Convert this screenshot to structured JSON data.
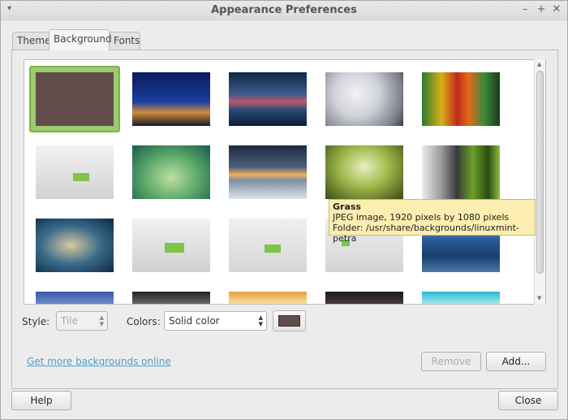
{
  "window": {
    "title": "Appearance Preferences"
  },
  "tabs": [
    {
      "label": "Theme"
    },
    {
      "label": "Background",
      "active": true
    },
    {
      "label": "Fonts"
    }
  ],
  "gallery": {
    "selected_index": 0,
    "tooltip": {
      "name": "Grass",
      "info": "JPEG image, 1920 pixels by 1080 pixels",
      "folder": "Folder: /usr/share/backgrounds/linuxmint-petra"
    }
  },
  "controls": {
    "style_label": "Style:",
    "style_value": "Tile",
    "colors_label": "Colors:",
    "colors_value": "Solid color",
    "swatch_color": "#634d4b"
  },
  "link": {
    "label": "Get more backgrounds online"
  },
  "buttons": {
    "remove": "Remove",
    "add": "Add...",
    "help": "Help",
    "close": "Close"
  }
}
